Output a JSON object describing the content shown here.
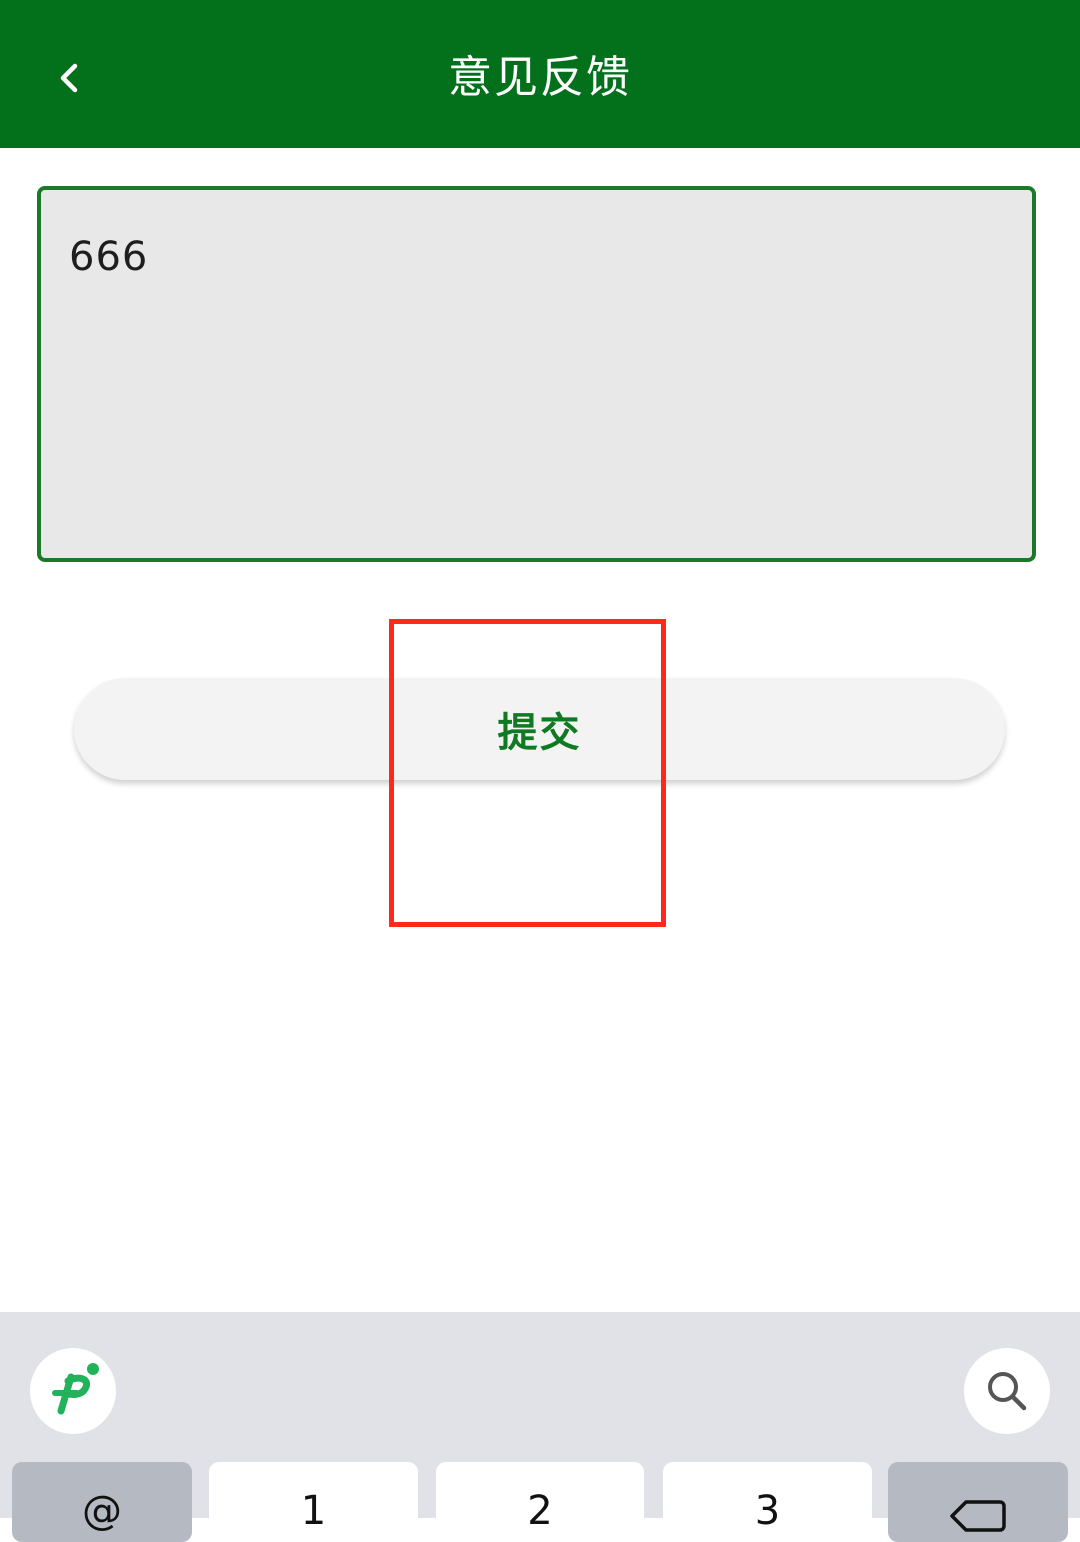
{
  "header": {
    "title": "意见反馈",
    "back_icon": "chevron-left-icon"
  },
  "feedback": {
    "value": "666"
  },
  "submit": {
    "label": "提交"
  },
  "keyboard": {
    "logo_icon": "ime-logo-icon",
    "search_icon": "search-icon",
    "keys": [
      "@",
      "1",
      "2",
      "3"
    ],
    "delete_icon": "backspace-icon"
  },
  "colors": {
    "header_bg": "#03701b",
    "accent_green": "#0f7a22",
    "input_bg": "#e8e8e8",
    "highlight_red": "#ff2a1a",
    "keyboard_bg": "#e1e2e7"
  }
}
